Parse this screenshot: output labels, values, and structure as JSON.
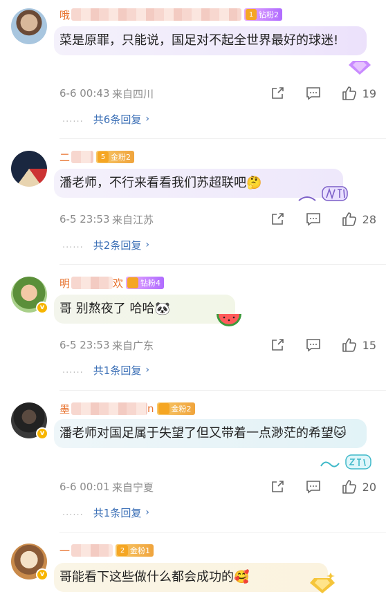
{
  "comments": [
    {
      "name": "哦",
      "fan_badge": "钻粉2",
      "badge_level": "1",
      "text": "菜是原罪，只能说，国足对不起全世界最好的球迷!",
      "time": "6-6 00:43",
      "location": "来自四川",
      "likes": "19",
      "replies": "共6条回复"
    },
    {
      "name": "二",
      "fan_badge": "金粉2",
      "badge_level": "5",
      "text": "潘老师，不行来看看我们苏超联吧🤔",
      "time": "6-5 23:53",
      "location": "来自江苏",
      "likes": "28",
      "replies": "共2条回复"
    },
    {
      "name": "明",
      "name_tail": "欢",
      "fan_badge": "钻粉4",
      "badge_level": "",
      "text": "哥 别熬夜了 哈哈🐼",
      "time": "6-5 23:53",
      "location": "来自广东",
      "likes": "15",
      "replies": "共1条回复"
    },
    {
      "name": "墨",
      "name_tail": "n",
      "fan_badge": "金粉2",
      "badge_level": "",
      "text": "潘老师对国足属于失望了但又带着一点渺茫的希望🐱",
      "time": "6-6 00:01",
      "location": "来自宁夏",
      "likes": "20",
      "replies": "共1条回复"
    },
    {
      "name": "一",
      "fan_badge": "金粉1",
      "badge_level": "2",
      "text": "哥能看下这些做什么都会成功的🥰",
      "time": "",
      "location": "",
      "likes": "",
      "replies": ""
    }
  ],
  "colors": {
    "name": "#e8732f",
    "reply_link": "#3b6fb6",
    "meta": "#8a8a8a"
  },
  "icons": {
    "share": "share-icon",
    "comment": "comment-icon",
    "like": "thumbs-up-icon",
    "chevron": "chevron-right-icon"
  }
}
